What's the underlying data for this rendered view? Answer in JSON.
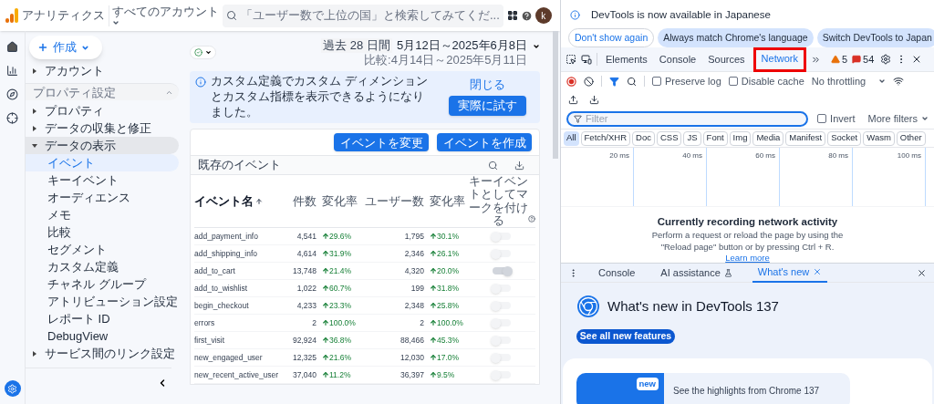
{
  "analytics": {
    "app_title": "アナリティクス",
    "account_label": "すべてのアカウント",
    "search_placeholder": "「ユーザー数で上位の国」と検索してみてくだ...",
    "avatar": "k",
    "create_button": "作成",
    "sidebar": [
      {
        "kind": "group",
        "label": "アカウント",
        "expanded": false
      },
      {
        "kind": "section",
        "label": "プロパティ設定",
        "expanded": true
      },
      {
        "kind": "group",
        "label": "プロパティ",
        "expanded": false
      },
      {
        "kind": "group",
        "label": "データの収集と修正",
        "expanded": false
      },
      {
        "kind": "group",
        "label": "データの表示",
        "expanded": true,
        "children": [
          {
            "label": "イベント",
            "selected": true
          },
          {
            "label": "キーイベント",
            "selected": false
          },
          {
            "label": "オーディエンス",
            "selected": false
          },
          {
            "label": "メモ",
            "selected": false
          },
          {
            "label": "比較",
            "selected": false
          },
          {
            "label": "セグメント",
            "selected": false
          },
          {
            "label": "カスタム定義",
            "selected": false
          },
          {
            "label": "チャネル グループ",
            "selected": false
          },
          {
            "label": "アトリビューション設定",
            "selected": false
          },
          {
            "label": "レポート ID",
            "selected": false
          },
          {
            "label": "DebugView",
            "selected": false
          }
        ]
      },
      {
        "kind": "group",
        "label": "サービス間のリンク設定",
        "expanded": false
      }
    ],
    "date": {
      "range_label": "過去 28 日間",
      "range": "5月12日～2025年6月8日",
      "compare": "比較:4月14日～2025年5月11日"
    },
    "banner": {
      "text": "カスタム定義でカスタム ディメンションとカスタム指標を表示できるようになりました。",
      "close": "閉じる",
      "action": "実際に試す"
    },
    "table": {
      "buttons": [
        "イベントを変更",
        "イベントを作成"
      ],
      "title": "既存のイベント",
      "columns": [
        "イベント名",
        "件数",
        "変化率",
        "ユーザー数",
        "変化率",
        "キーイベントとしてマークを付ける"
      ],
      "rows": [
        {
          "name": "add_payment_info",
          "count": "4,541",
          "count_change": "29.6%",
          "users": "1,795",
          "users_change": "30.1%",
          "key_event": false
        },
        {
          "name": "add_shipping_info",
          "count": "4,614",
          "count_change": "31.9%",
          "users": "2,346",
          "users_change": "26.1%",
          "key_event": false
        },
        {
          "name": "add_to_cart",
          "count": "13,748",
          "count_change": "21.4%",
          "users": "4,320",
          "users_change": "20.0%",
          "key_event": true
        },
        {
          "name": "add_to_wishlist",
          "count": "1,022",
          "count_change": "60.7%",
          "users": "199",
          "users_change": "31.8%",
          "key_event": false
        },
        {
          "name": "begin_checkout",
          "count": "4,233",
          "count_change": "23.3%",
          "users": "2,348",
          "users_change": "25.8%",
          "key_event": false
        },
        {
          "name": "errors",
          "count": "2",
          "count_change": "100.0%",
          "users": "2",
          "users_change": "100.0%",
          "key_event": false
        },
        {
          "name": "first_visit",
          "count": "92,924",
          "count_change": "36.8%",
          "users": "88,466",
          "users_change": "45.3%",
          "key_event": false
        },
        {
          "name": "new_engaged_user",
          "count": "12,325",
          "count_change": "21.6%",
          "users": "12,030",
          "users_change": "17.0%",
          "key_event": false
        },
        {
          "name": "new_recent_active_user",
          "count": "37,040",
          "count_change": "11.2%",
          "users": "36,397",
          "users_change": "9.5%",
          "key_event": false
        }
      ]
    }
  },
  "devtools": {
    "notice": {
      "text": "DevTools is now available in Japanese",
      "buttons": [
        {
          "label": "Don't show again",
          "kind": "outline"
        },
        {
          "label": "Always match Chrome's language",
          "kind": "tonal"
        },
        {
          "label": "Switch DevTools to Japan",
          "kind": "tonal"
        }
      ]
    },
    "tabs": [
      {
        "label": "Elements",
        "selected": false,
        "highlighted": false
      },
      {
        "label": "Console",
        "selected": false,
        "highlighted": false
      },
      {
        "label": "Sources",
        "selected": false,
        "highlighted": false
      },
      {
        "label": "Network",
        "selected": true,
        "highlighted": true
      }
    ],
    "warnings": "5",
    "errors": "54",
    "preserve_log": {
      "label": "Preserve log",
      "checked": false
    },
    "disable_cache": {
      "label": "Disable cache",
      "checked": false
    },
    "throttling": "No throttling",
    "filter": {
      "placeholder": "Filter"
    },
    "invert": {
      "label": "Invert",
      "checked": false
    },
    "more_filters": "More filters",
    "types": [
      {
        "label": "All",
        "selected": true
      },
      {
        "label": "Fetch/XHR",
        "selected": false
      },
      {
        "label": "Doc",
        "selected": false
      },
      {
        "label": "CSS",
        "selected": false
      },
      {
        "label": "JS",
        "selected": false
      },
      {
        "label": "Font",
        "selected": false
      },
      {
        "label": "Img",
        "selected": false
      },
      {
        "label": "Media",
        "selected": false
      },
      {
        "label": "Manifest",
        "selected": false
      },
      {
        "label": "Socket",
        "selected": false
      },
      {
        "label": "Wasm",
        "selected": false
      },
      {
        "label": "Other",
        "selected": false
      }
    ],
    "ticks": [
      "20 ms",
      "40 ms",
      "60 ms",
      "80 ms",
      "100 ms"
    ],
    "empty": {
      "title": "Currently recording network activity",
      "text": "Perform a request or reload the page by using the \"Reload page\" button or by pressing Ctrl + R.",
      "link": "Learn more"
    },
    "drawer": {
      "tabs": [
        {
          "label": "Console",
          "selected": false,
          "closable": false
        },
        {
          "label": "AI assistance",
          "selected": false,
          "closable": false
        },
        {
          "label": "What's new",
          "selected": true,
          "closable": true
        }
      ],
      "title": "What's new in DevTools 137",
      "button": "See all new features",
      "card": {
        "badge": "new",
        "text": "See the highlights from Chrome 137"
      }
    }
  }
}
